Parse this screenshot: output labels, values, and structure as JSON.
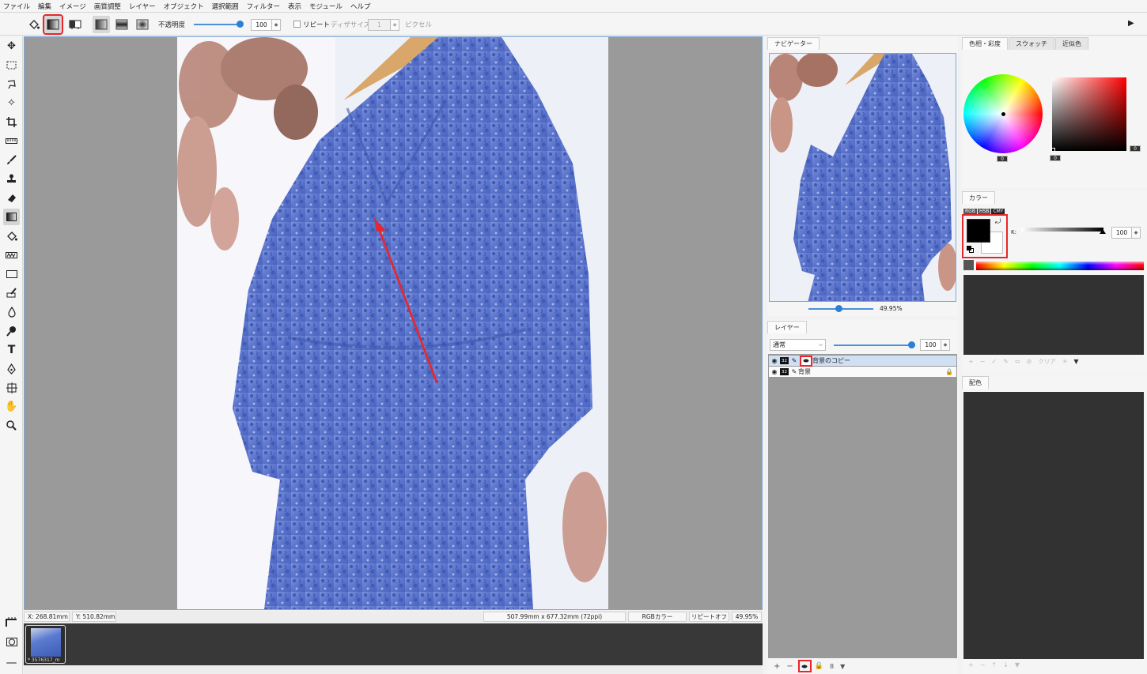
{
  "menu": [
    "ファイル",
    "編集",
    "イメージ",
    "画質調整",
    "レイヤー",
    "オブジェクト",
    "選択範囲",
    "フィルター",
    "表示",
    "モジュール",
    "ヘルプ"
  ],
  "options": {
    "opacity_label": "不透明度",
    "opacity_value": "100",
    "repeat_label": "リピート",
    "dither_label": "ディザサイズ",
    "dither_value": "1",
    "pixel_label": "ピクセル",
    "gradient_mode": "linear"
  },
  "tools": [
    "move-icon",
    "rect-select-icon",
    "lasso-icon",
    "magic-wand-icon",
    "crop-icon",
    "ruler-icon",
    "brush-icon",
    "stamp-icon",
    "eraser-icon",
    "gradient-icon",
    "fill-bucket-icon",
    "smudge-icon",
    "rectangle-shape-icon",
    "retouch-icon",
    "drop-icon",
    "dodge-icon",
    "text-icon",
    "pen-icon",
    "transform-icon",
    "hand-icon",
    "zoom-icon"
  ],
  "status": {
    "x": "X:  268.81mm",
    "y": "Y:  510.82mm",
    "size": "507.99mm x 677.32mm (72ppi)",
    "color_mode": "RGBカラー",
    "repeat": "リピートオフ",
    "zoom": "49.95%"
  },
  "filmstrip": {
    "thumb_caption": "* 3576317_m"
  },
  "navigator": {
    "tab": "ナビゲーター",
    "zoom": "49.95%"
  },
  "layers": {
    "tab": "レイヤー",
    "blend_mode": "通常",
    "opacity": "100",
    "items": [
      {
        "name": "背景のコピー",
        "selected": true,
        "locked": false
      },
      {
        "name": "背景",
        "selected": false,
        "locked": true
      }
    ],
    "footer_count": "8"
  },
  "color_wheel": {
    "tabs": [
      "色相・彩度",
      "スウォッチ",
      "近似色"
    ],
    "hue_value": "0",
    "sat_value": "0",
    "bright_value": "0"
  },
  "color": {
    "tab": "カラー",
    "modes": [
      "RGB",
      "HSB",
      "CMY"
    ],
    "channel_label": "K:",
    "channel_value": "100",
    "foreground": "#000000",
    "background": "#ffffff",
    "swatch_footer_clear": "クリア"
  },
  "palette": {
    "tab": "配色"
  },
  "accent": {
    "highlight": "#e8262b",
    "selection": "#cfe0f5",
    "slider": "#2c7fd6"
  }
}
